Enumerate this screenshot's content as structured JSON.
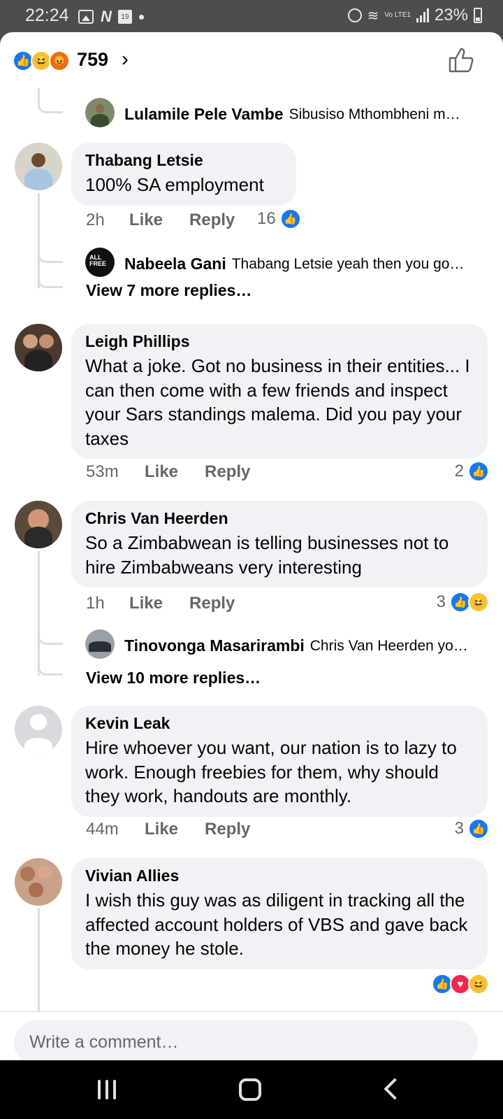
{
  "status_bar": {
    "time": "22:24",
    "battery": "23%",
    "network": "Vo LTE1",
    "calendar_day": "19"
  },
  "reactions": {
    "count": "759",
    "types": [
      "like",
      "haha",
      "angry"
    ]
  },
  "comments": [
    {
      "reply_preview": {
        "author": "Lulamile Pele Vambe",
        "text": "Sibusiso Mthombheni m…"
      }
    },
    {
      "author": "Thabang Letsie",
      "text": "100% SA employment",
      "time": "2h",
      "like": "Like",
      "reply": "Reply",
      "reaction_count": "16",
      "reply_preview": {
        "author": "Nabeela Gani",
        "text": "Thabang Letsie yeah then you go…"
      },
      "view_more": "View 7 more replies…"
    },
    {
      "author": "Leigh Phillips",
      "text": "What a joke. Got no business in their entities... I can then come with a few friends and inspect your Sars standings malema. Did you pay your taxes",
      "time": "53m",
      "like": "Like",
      "reply": "Reply",
      "reaction_count": "2"
    },
    {
      "author": "Chris Van Heerden",
      "text": "So a Zimbabwean is telling businesses not to hire Zimbabweans very interesting",
      "time": "1h",
      "like": "Like",
      "reply": "Reply",
      "reaction_count": "3",
      "reply_preview": {
        "author": "Tinovonga Masarirambi",
        "text": "Chris Van Heerden yo…"
      },
      "view_more": "View 10 more replies…"
    },
    {
      "author": "Kevin Leak",
      "text": "Hire whoever you want, our nation is to lazy to work. Enough freebies for them, why should they work, handouts are monthly.",
      "time": "44m",
      "like": "Like",
      "reply": "Reply",
      "reaction_count": "3"
    },
    {
      "author": "Vivian Allies",
      "text": "I wish this guy was as diligent in tracking all the affected account holders of VBS and gave back the money he stole."
    }
  ],
  "composer": {
    "placeholder": "Write a comment…"
  },
  "colors": {
    "facebook_blue": "#1877f2",
    "bubble_bg": "#f0f2f5",
    "meta_gray": "#65676b"
  }
}
